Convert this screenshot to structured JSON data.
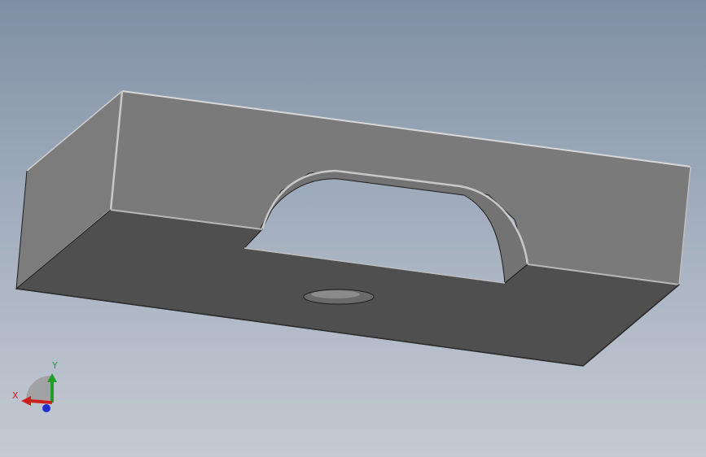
{
  "viewport": {
    "background_top": "#7f8fa3",
    "background_bottom": "#c4cad3"
  },
  "model": {
    "face_colors": {
      "left_face": "#7c7c7c",
      "back_face": "#7a7a7a",
      "bottom_face": "#4f4f4f",
      "cutout_wall": "#737373",
      "hole": "#6a6a6a",
      "edge_line": "#1e1e1e",
      "fillet_highlight": "#c8c8c8"
    }
  },
  "triad": {
    "x_label": "X",
    "y_label": "Y",
    "x_color": "#cc1f1f",
    "y_color": "#1f9e2a",
    "z_color": "#1f2fd0"
  }
}
